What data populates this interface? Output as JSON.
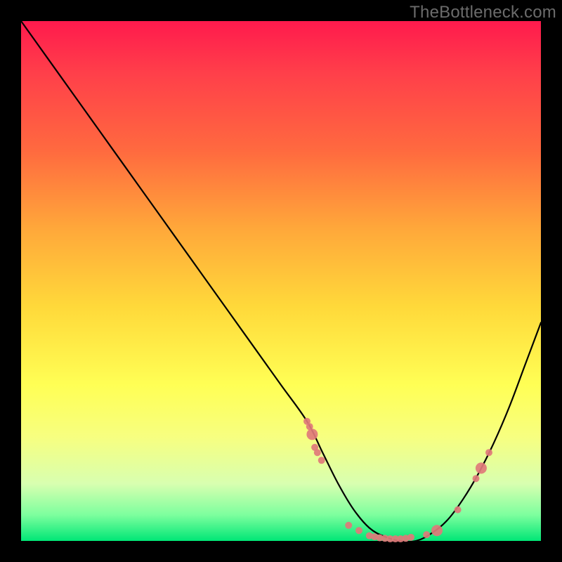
{
  "watermark": "TheBottleneck.com",
  "chart_data": {
    "type": "line",
    "title": "",
    "xlabel": "",
    "ylabel": "",
    "xlim": [
      0,
      100
    ],
    "ylim": [
      0,
      100
    ],
    "grid": false,
    "legend": false,
    "description": "V-shaped bottleneck curve overlaid on a vertical rainbow gradient (red = high bottleneck at top, green = no bottleneck at bottom). The curve starts very high at the left, descends steeply to a flat optimum basin, then rises again on the right.",
    "series": [
      {
        "name": "bottleneck-curve",
        "color": "#000000",
        "x": [
          0,
          5,
          10,
          15,
          20,
          25,
          30,
          35,
          40,
          45,
          50,
          55,
          58,
          61,
          64,
          67,
          70,
          73,
          76,
          79,
          82,
          85,
          88,
          91,
          94,
          97,
          100
        ],
        "y": [
          100,
          93,
          86,
          79,
          72,
          65,
          58,
          51,
          44,
          37,
          30,
          23,
          17,
          11,
          6,
          2.5,
          0.8,
          0,
          0,
          1.5,
          4,
          8,
          13,
          19,
          26,
          34,
          42
        ]
      }
    ],
    "markers": {
      "name": "datapoints",
      "color": "#e07a7a",
      "radius_small": 5,
      "radius_large": 8,
      "points": [
        {
          "x": 55,
          "y": 23,
          "r": "s"
        },
        {
          "x": 55.5,
          "y": 22,
          "r": "s"
        },
        {
          "x": 56,
          "y": 20.5,
          "r": "l"
        },
        {
          "x": 56.5,
          "y": 18,
          "r": "s"
        },
        {
          "x": 57,
          "y": 17,
          "r": "s"
        },
        {
          "x": 57.8,
          "y": 15.5,
          "r": "s"
        },
        {
          "x": 63,
          "y": 3,
          "r": "s"
        },
        {
          "x": 65,
          "y": 2,
          "r": "s"
        },
        {
          "x": 67,
          "y": 1,
          "r": "s"
        },
        {
          "x": 68,
          "y": 0.8,
          "r": "s"
        },
        {
          "x": 69,
          "y": 0.6,
          "r": "s"
        },
        {
          "x": 70,
          "y": 0.5,
          "r": "s"
        },
        {
          "x": 71,
          "y": 0.4,
          "r": "s"
        },
        {
          "x": 72,
          "y": 0.4,
          "r": "s"
        },
        {
          "x": 73,
          "y": 0.4,
          "r": "s"
        },
        {
          "x": 74,
          "y": 0.5,
          "r": "s"
        },
        {
          "x": 75,
          "y": 0.7,
          "r": "s"
        },
        {
          "x": 78,
          "y": 1.2,
          "r": "s"
        },
        {
          "x": 80,
          "y": 2,
          "r": "l"
        },
        {
          "x": 84,
          "y": 6,
          "r": "s"
        },
        {
          "x": 87.5,
          "y": 12,
          "r": "s"
        },
        {
          "x": 88.5,
          "y": 14,
          "r": "l"
        },
        {
          "x": 90,
          "y": 17,
          "r": "s"
        }
      ]
    }
  }
}
